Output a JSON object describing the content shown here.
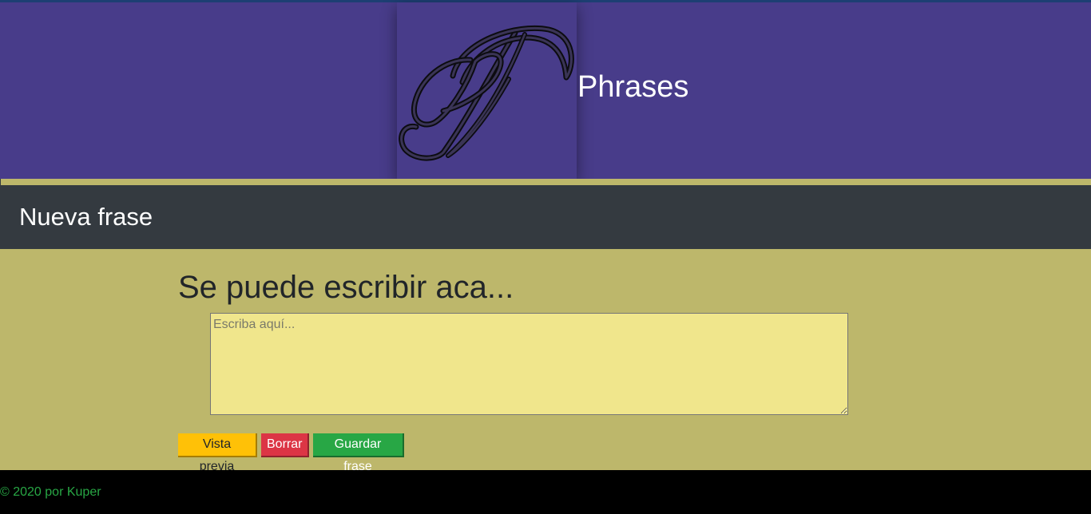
{
  "header": {
    "brand": "Phrases",
    "logo_icon": "script-letter-p-logo",
    "background": "#483c8a"
  },
  "section": {
    "title": "Nueva frase",
    "background": "#343a40"
  },
  "editor": {
    "prompt": "Se puede escribir aca...",
    "placeholder": "Escriba aquí...",
    "value": "",
    "background": "#f0e68c"
  },
  "actions": {
    "preview_label": "Vista previa",
    "delete_label": "Borrar",
    "save_label": "Guardar frase",
    "colors": {
      "preview": "#ffc107",
      "delete": "#dc3545",
      "save": "#28a745"
    }
  },
  "footer": {
    "text": "© 2020 por Kuper",
    "text_color": "#28a745"
  },
  "page": {
    "background": "#bdb76b"
  }
}
